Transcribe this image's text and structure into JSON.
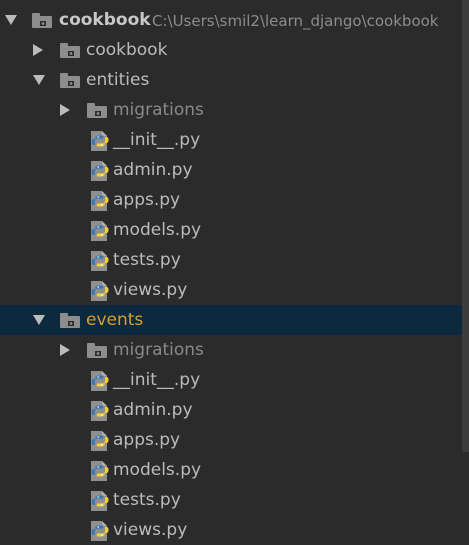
{
  "project": {
    "root_label": "cookbook",
    "root_path": "C:\\Users\\smil2\\learn_django\\cookbook"
  },
  "tree": {
    "rows": [
      {
        "label": "cookbook"
      },
      {
        "label": "entities"
      },
      {
        "label": "migrations"
      },
      {
        "label": "__init__.py"
      },
      {
        "label": "admin.py"
      },
      {
        "label": "apps.py"
      },
      {
        "label": "models.py"
      },
      {
        "label": "tests.py"
      },
      {
        "label": "views.py"
      },
      {
        "label": "events"
      },
      {
        "label": "migrations"
      },
      {
        "label": "__init__.py"
      },
      {
        "label": "admin.py"
      },
      {
        "label": "apps.py"
      },
      {
        "label": "models.py"
      },
      {
        "label": "tests.py"
      },
      {
        "label": "views.py"
      }
    ]
  },
  "colors": {
    "background": "#2b2b2b",
    "selection": "#0d293e",
    "selected_text": "#d69f2b",
    "text": "#bbbbbb",
    "dim_text": "#8a8a8a",
    "folder": "#8d8d8d",
    "python_blue": "#3c79b4",
    "python_yellow": "#f4cf3a"
  },
  "icons": {
    "expanded": "chevron-down-icon",
    "collapsed": "chevron-right-icon",
    "folder": "folder-icon",
    "python_file": "python-file-icon"
  }
}
